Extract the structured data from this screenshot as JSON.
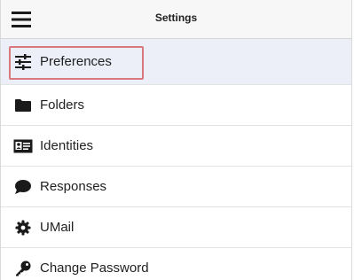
{
  "header": {
    "title": "Settings",
    "menu_icon": "hamburger-icon"
  },
  "menu": {
    "items": [
      {
        "label": "Preferences",
        "icon": "sliders-icon",
        "selected": true
      },
      {
        "label": "Folders",
        "icon": "folder-icon"
      },
      {
        "label": "Identities",
        "icon": "id-card-icon"
      },
      {
        "label": "Responses",
        "icon": "speech-bubble-icon"
      },
      {
        "label": "UMail",
        "icon": "gear-icon"
      },
      {
        "label": "Change Password",
        "icon": "key-icon"
      }
    ]
  },
  "colors": {
    "header_bg": "#f7f7f7",
    "selected_bg": "#eceef8",
    "highlight_border": "#d9787d",
    "icon": "#1a1a1a"
  }
}
